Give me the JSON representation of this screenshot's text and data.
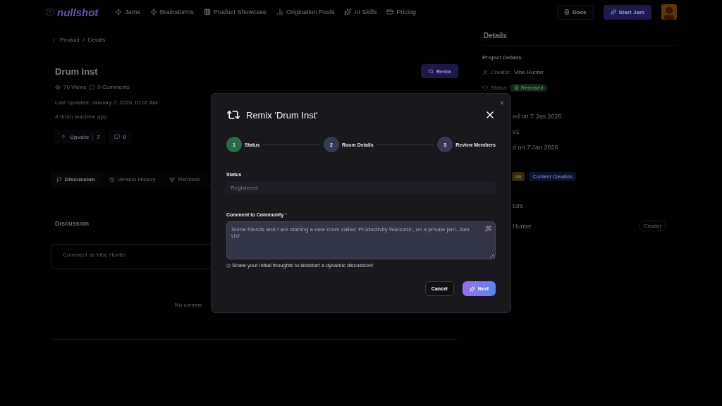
{
  "nav": {
    "logo": "nullshot",
    "links": [
      "Jams",
      "Brainstorms",
      "Product Showcase",
      "Origination Pools",
      "AI Skills",
      "Pricing"
    ],
    "docs": "Docs",
    "start_jam": "Start Jam"
  },
  "breadcrumb": {
    "items": [
      "Product",
      "Details"
    ],
    "separator": "/"
  },
  "project": {
    "title": "Drum Inst",
    "views": "70 Views",
    "comments": "0 Comments",
    "updated": "Last Updated: January 7, 2026 10:02 AM",
    "description": "A drum machine app.",
    "upvote": "Upvote",
    "upvote_count": "7",
    "comment_count": "0",
    "remix": "Remix"
  },
  "tabs": [
    {
      "label": "Discussion",
      "selected": true
    },
    {
      "label": "Version History",
      "selected": false
    },
    {
      "label": "Remixes",
      "selected": false
    }
  ],
  "discussion": {
    "title": "Discussion",
    "placeholder": "Comment as Vibe Hunter",
    "empty": "No comme"
  },
  "details": {
    "title": "Details",
    "section": "Project Details",
    "creator_label": "Creator:",
    "creator": "Vibe Hunter",
    "status_label": "Status",
    "status": "Released",
    "rows": [
      "ed on  7 Jan 2026",
      "v1",
      "d on  7 Jan 2026"
    ],
    "tags": [
      {
        "label": "on",
        "color": "#3a2a08"
      },
      {
        "label": "Content Creation",
        "color": "#0c1230"
      }
    ],
    "contributors_title": "tors",
    "contributors": [
      {
        "name": "Hunter",
        "role": "Creator"
      }
    ]
  },
  "modal": {
    "title": "Remix 'Drum Inst'",
    "steps": [
      {
        "number": "1",
        "label": "Status",
        "selected": true
      },
      {
        "number": "2",
        "label": "Room Details",
        "selected": false
      },
      {
        "number": "3",
        "label": "Review Members",
        "selected": false
      }
    ],
    "status_label": "Status",
    "status_value": "Registered",
    "status_disabled": true,
    "comment_label": "Comment to Community",
    "required_mark": "*",
    "comment_value": "Some friends and I are starting a new room called 'Productivity Warlords', on a private jam. Join Us!",
    "hint": "Share your initial thoughts to kickstart a dynamic discussion!",
    "cancel": "Cancel",
    "next": "Next"
  }
}
